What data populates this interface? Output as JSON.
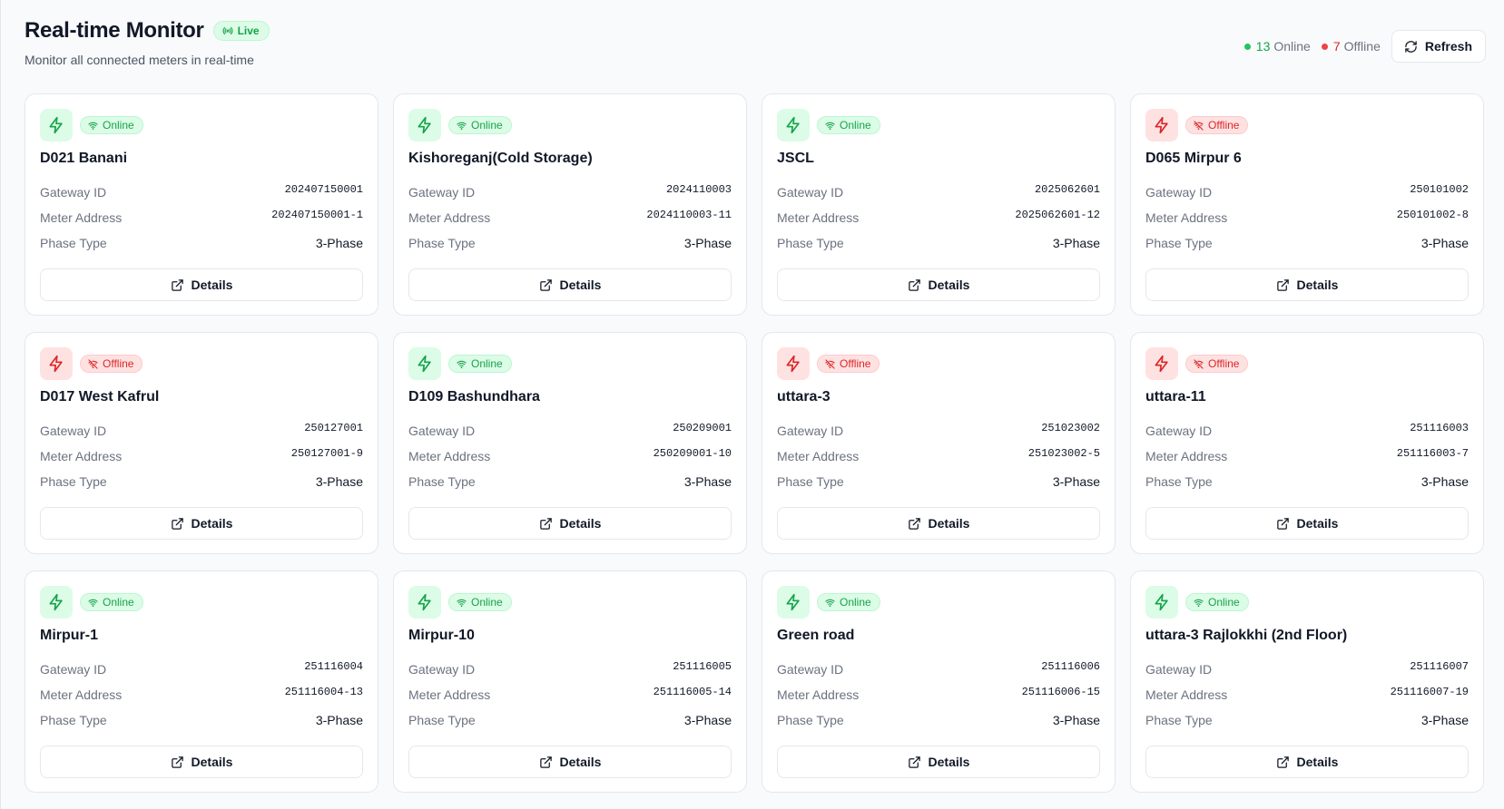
{
  "header": {
    "title": "Real-time Monitor",
    "live_label": "Live",
    "subtitle": "Monitor all connected meters in real-time",
    "online_count": "13",
    "online_label": "Online",
    "offline_count": "7",
    "offline_label": "Offline",
    "refresh_label": "Refresh"
  },
  "labels": {
    "gateway_id": "Gateway ID",
    "meter_address": "Meter Address",
    "phase_type": "Phase Type",
    "details": "Details"
  },
  "colors": {
    "online": "#16a34a",
    "offline": "#dc2626"
  },
  "meters": [
    {
      "name": "D021 Banani",
      "status": "online",
      "status_label": "Online",
      "gateway_id": "202407150001",
      "meter_address": "202407150001-1",
      "phase_type": "3-Phase"
    },
    {
      "name": "Kishoreganj(Cold Storage)",
      "status": "online",
      "status_label": "Online",
      "gateway_id": "2024110003",
      "meter_address": "2024110003-11",
      "phase_type": "3-Phase"
    },
    {
      "name": "JSCL",
      "status": "online",
      "status_label": "Online",
      "gateway_id": "2025062601",
      "meter_address": "2025062601-12",
      "phase_type": "3-Phase"
    },
    {
      "name": "D065 Mirpur 6",
      "status": "offline",
      "status_label": "Offline",
      "gateway_id": "250101002",
      "meter_address": "250101002-8",
      "phase_type": "3-Phase"
    },
    {
      "name": "D017 West Kafrul",
      "status": "offline",
      "status_label": "Offline",
      "gateway_id": "250127001",
      "meter_address": "250127001-9",
      "phase_type": "3-Phase"
    },
    {
      "name": "D109 Bashundhara",
      "status": "online",
      "status_label": "Online",
      "gateway_id": "250209001",
      "meter_address": "250209001-10",
      "phase_type": "3-Phase"
    },
    {
      "name": "uttara-3",
      "status": "offline",
      "status_label": "Offline",
      "gateway_id": "251023002",
      "meter_address": "251023002-5",
      "phase_type": "3-Phase"
    },
    {
      "name": "uttara-11",
      "status": "offline",
      "status_label": "Offline",
      "gateway_id": "251116003",
      "meter_address": "251116003-7",
      "phase_type": "3-Phase"
    },
    {
      "name": "Mirpur-1",
      "status": "online",
      "status_label": "Online",
      "gateway_id": "251116004",
      "meter_address": "251116004-13",
      "phase_type": "3-Phase"
    },
    {
      "name": "Mirpur-10",
      "status": "online",
      "status_label": "Online",
      "gateway_id": "251116005",
      "meter_address": "251116005-14",
      "phase_type": "3-Phase"
    },
    {
      "name": "Green road",
      "status": "online",
      "status_label": "Online",
      "gateway_id": "251116006",
      "meter_address": "251116006-15",
      "phase_type": "3-Phase"
    },
    {
      "name": "uttara-3 Rajlokkhi (2nd Floor)",
      "status": "online",
      "status_label": "Online",
      "gateway_id": "251116007",
      "meter_address": "251116007-19",
      "phase_type": "3-Phase"
    }
  ]
}
